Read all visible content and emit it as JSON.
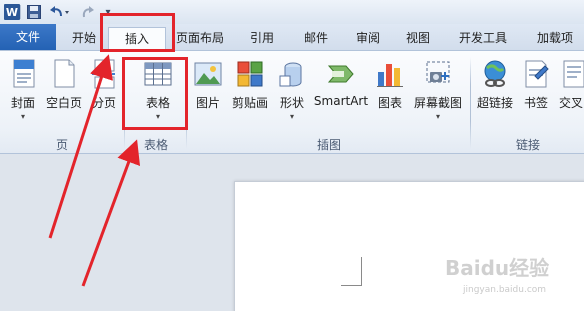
{
  "app": {
    "logo_letter": "W"
  },
  "quick_access": {
    "save_icon": "floppy-disk-icon",
    "undo_icon": "undo-arrow-icon",
    "redo_icon": "redo-arrow-icon",
    "more_label": "▾"
  },
  "tabs": [
    {
      "label": "文件",
      "active": false
    },
    {
      "label": "开始",
      "active": false
    },
    {
      "label": "插入",
      "active": true
    },
    {
      "label": "页面布局",
      "active": false
    },
    {
      "label": "引用",
      "active": false
    },
    {
      "label": "邮件",
      "active": false
    },
    {
      "label": "审阅",
      "active": false
    },
    {
      "label": "视图",
      "active": false
    },
    {
      "label": "开发工具",
      "active": false
    },
    {
      "label": "加载项",
      "active": false
    }
  ],
  "ribbon": {
    "groups": [
      {
        "label": "页"
      },
      {
        "label": "表格"
      },
      {
        "label": "插图"
      },
      {
        "label": "链接"
      }
    ],
    "commands": [
      {
        "label": "封面",
        "icon": "cover-page-icon",
        "dropdown": "▾"
      },
      {
        "label": "空白页",
        "icon": "blank-page-icon"
      },
      {
        "label": "分页",
        "icon": "page-break-icon"
      },
      {
        "label": "表格",
        "icon": "table-icon",
        "dropdown": "▾"
      },
      {
        "label": "图片",
        "icon": "picture-icon"
      },
      {
        "label": "剪贴画",
        "icon": "clip-art-icon"
      },
      {
        "label": "形状",
        "icon": "shapes-icon",
        "dropdown": "▾"
      },
      {
        "label": "SmartArt",
        "icon": "smartart-icon"
      },
      {
        "label": "图表",
        "icon": "chart-icon"
      },
      {
        "label": "屏幕截图",
        "icon": "screenshot-icon",
        "dropdown": "▾"
      },
      {
        "label": "超链接",
        "icon": "hyperlink-icon"
      },
      {
        "label": "书签",
        "icon": "bookmark-icon"
      },
      {
        "label": "交叉",
        "icon": "cross-reference-icon"
      }
    ]
  },
  "watermark": {
    "brand": "Baidu经验",
    "url": "jingyan.baidu.com"
  },
  "colors": {
    "annotation": "#e3242b",
    "file_tab": "#2b64b4",
    "accent": "#2b579a"
  }
}
